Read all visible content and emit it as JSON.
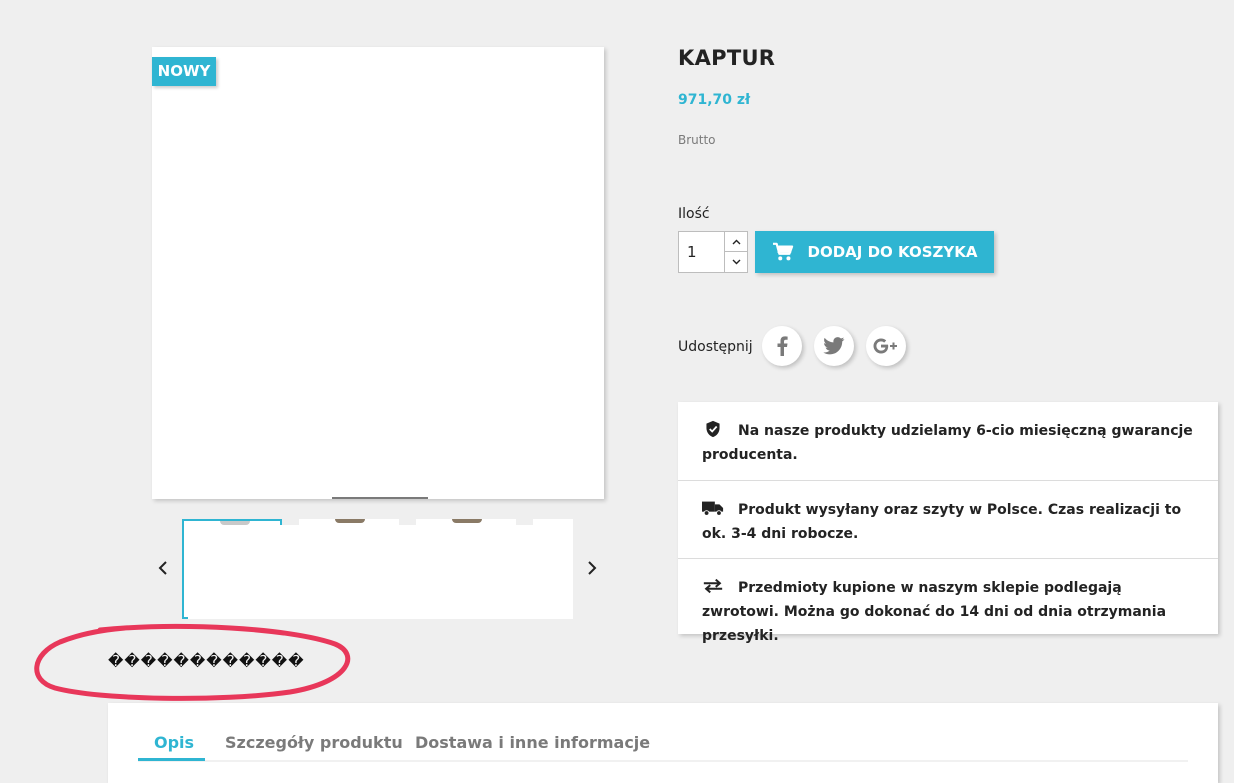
{
  "product": {
    "title": "KAPTUR",
    "price": "971,70 zł",
    "tax_label": "Brutto",
    "badge": "NOWY",
    "thumbnail_count": 4,
    "garbled_text": "������������"
  },
  "cart": {
    "quantity_label": "Ilość",
    "quantity_value": "1",
    "add_to_cart_label": "DODAJ DO KOSZYKA"
  },
  "share": {
    "label": "Udostępnij",
    "networks": [
      "facebook-icon",
      "twitter-icon",
      "google-plus-icon"
    ]
  },
  "reassurance": [
    {
      "icon": "shield-check-icon",
      "text": "Na nasze produkty udzielamy 6-cio miesięczną gwarancje producenta."
    },
    {
      "icon": "truck-icon",
      "text": "Produkt wysyłany oraz szyty w Polsce. Czas realizacji to ok. 3-4 dni robocze."
    },
    {
      "icon": "swap-arrows-icon",
      "text": "Przedmioty kupione w naszym sklepie podlegają zwrotowi. Można go dokonać do 14 dni od dnia otrzymania przesyłki."
    }
  ],
  "tabs": [
    {
      "label": "Opis",
      "active": true
    },
    {
      "label": "Szczegóły produktu",
      "active": false
    },
    {
      "label": "Dostawa i inne informacje",
      "active": false
    }
  ],
  "colors": {
    "accent": "#2fb5d2",
    "background": "#efefef",
    "annotation": "#e8375a"
  }
}
